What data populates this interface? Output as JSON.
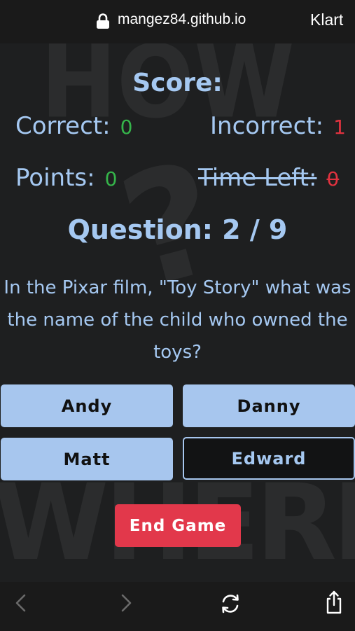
{
  "browser": {
    "url": "mangez84.github.io",
    "done_label": "Klart"
  },
  "background": {
    "words": [
      "HOW",
      "WHERE",
      "?"
    ]
  },
  "score": {
    "title": "Score:",
    "correct_label": "Correct:",
    "correct_value": "0",
    "incorrect_label": "Incorrect:",
    "incorrect_value": "1",
    "points_label": "Points:",
    "points_value": "0",
    "time_left_label": "Time Left:",
    "time_left_value": "0"
  },
  "question": {
    "counter": "Question: 2 / 9",
    "lines": [
      "In the Pixar film, \"Toy Story\" what was",
      "the name of the child who owned the",
      "toys?"
    ]
  },
  "answers": [
    "Andy",
    "Danny",
    "Matt",
    "Edward"
  ],
  "end_button": "End Game",
  "colors": {
    "accent": "#a5c8f1",
    "correct": "#35b44a",
    "incorrect": "#e0323f",
    "end_button": "#e2384b"
  },
  "toolbar_icons": [
    "back-icon",
    "forward-icon",
    "reload-icon",
    "share-icon"
  ]
}
